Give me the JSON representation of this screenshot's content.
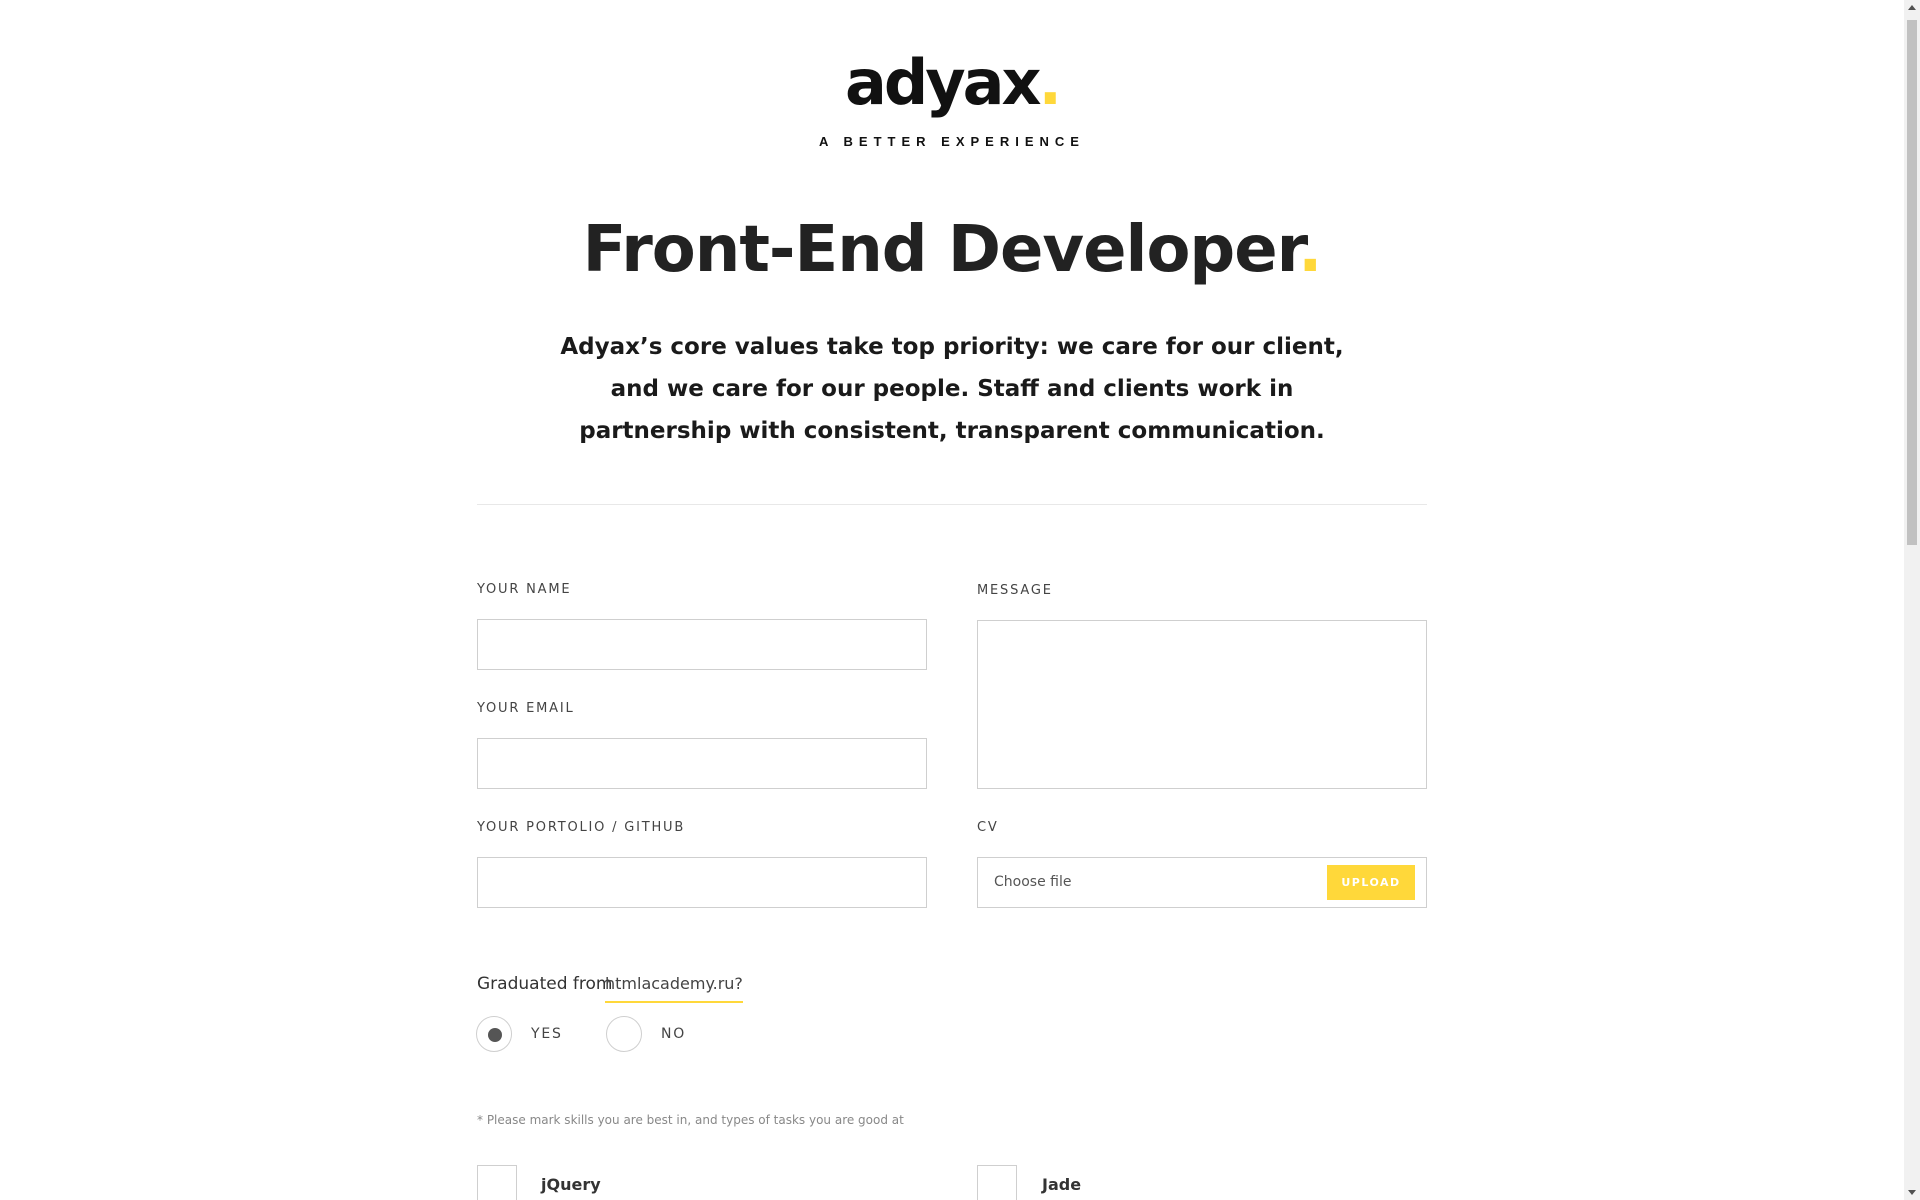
{
  "brand": {
    "logo_text": "adyax",
    "logo_dot": ".",
    "tagline": "A BETTER EXPERIENCE",
    "accent_color": "#ffd83a"
  },
  "hero": {
    "title": "Front-End Developer",
    "title_dot": ".",
    "intro": "Adyax’s core values take top priority: we care for our client, and we care for our people. Staff and clients work in partnership with consistent, transparent communication."
  },
  "form": {
    "name_label": "YOUR NAME",
    "email_label": "YOUR EMAIL",
    "portfolio_label": "YOUR PORTOLIO / GITHUB",
    "message_label": "MESSAGE",
    "cv_label": "CV",
    "cv_placeholder": "Choose file",
    "upload_button": "UPLOAD",
    "graduated_question": "Graduated from",
    "graduated_link": "htmlacademy.ru?",
    "radio_yes": "YES",
    "radio_no": "NO",
    "radio_selected": "YES",
    "skills_note": "* Please mark skills you are best in, and types of tasks you are good at",
    "skills": [
      "jQuery",
      "Jade"
    ]
  }
}
